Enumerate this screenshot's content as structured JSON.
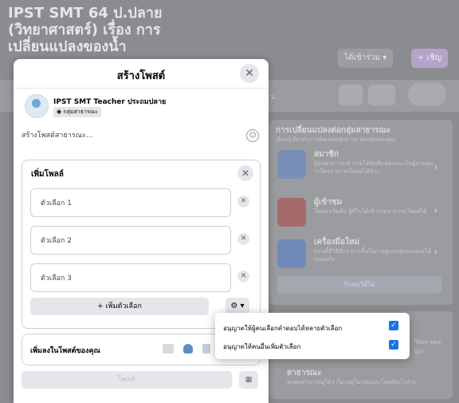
{
  "background": {
    "group_title_lines": [
      "IPST SMT 64 ป.ปลาย",
      "(วิทยาศาสตร์) เรื่อง การ",
      "เปลี่ยนแปลงของน้ำ"
    ],
    "join_button": "ได้เข้าร่วม ▾",
    "invite_button": "+ เชิญ",
    "tab_fragment": "ม",
    "side_card": {
      "title": "การเปลี่ยนแปลงต่อกลุ่มสาธารณะ",
      "subtitle": "เรียนรู้เกี่ยวกับการอัพเดตหลักต่างๆ ต่อกลุ่มของคุณ",
      "items": [
        {
          "title": "สมาชิก",
          "desc": "ผู้คนสามารถเข้าร่วมได้ทันทีแต่คุณจะเป็นผู้ควบคุมว่าใครสามารถโพสต์ได้บ้าง",
          "icon": "members-icon",
          "color": "#7a8fb7"
        },
        {
          "title": "ผู้เข้าชม",
          "desc": "โดยค่าเริ่มต้น ผู้ที่ไม่ได้เข้าร่วมสามารถโพสต์ได้",
          "icon": "visitor-icon",
          "color": "#a66a6a"
        },
        {
          "title": "เครื่องมือใหม่",
          "desc": "ตอนนี้มีวิธีอื่นๆ มากขึ้นในการดูแลกลุ่มของคุณให้ปลอดภัย",
          "icon": "tools-icon",
          "color": "#6f8ab8"
        }
      ],
      "button": "รับชมวิดีโอ"
    },
    "side_card2": {
      "fragment1": "ให้ทราบผล",
      "fragment2": "ผู้นำ",
      "public_title": "สาธารณะ",
      "public_desc": "ทุกคนสามารถดูได้ว่าใครอยู่ในกลุ่มและโพสต์อะไรบ้าง"
    }
  },
  "modal": {
    "title": "สร้างโพสต์",
    "author": {
      "name": "IPST SMT Teacher ประถมปลาย",
      "audience": "กลุ่มสาธารณะ"
    },
    "composer_placeholder": "สร้างโพสต์สาธารณะ...",
    "poll": {
      "title": "เพิ่มโพลล์",
      "options": [
        "ตัวเลือก 1",
        "ตัวเลือก 2",
        "ตัวเลือก 3"
      ],
      "add_option": "+ เพิ่มตัวเลือก"
    },
    "add_to_post_label": "เพิ่มลงในโพสต์ของคุณ",
    "post_button": "โพสต์",
    "poll_settings": [
      {
        "label": "อนุญาตให้ผู้คนเลือกคำตอบได้หลายตัวเลือก",
        "checked": true
      },
      {
        "label": "อนุญาตให้คนอื่นเพิ่มตัวเลือก",
        "checked": true
      }
    ]
  }
}
